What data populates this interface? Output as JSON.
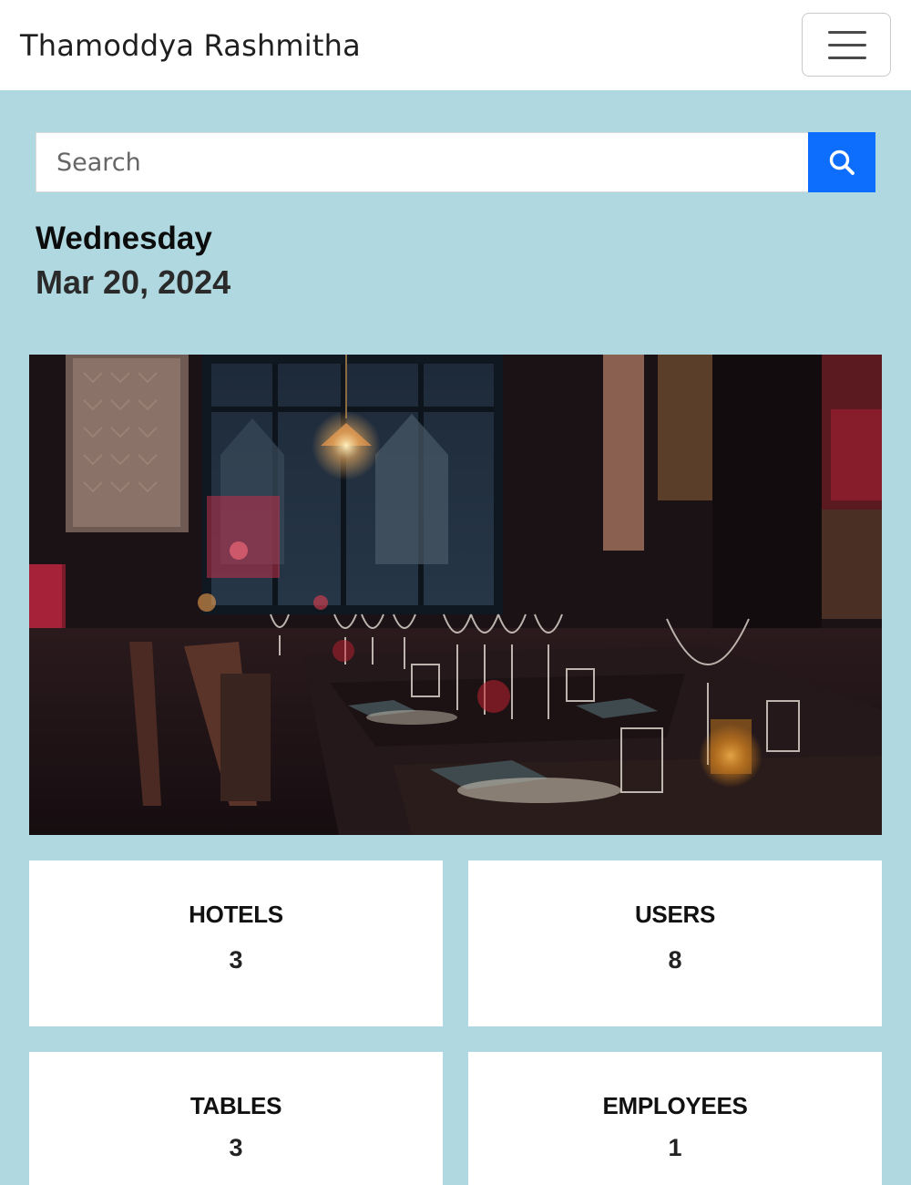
{
  "navbar": {
    "brand": "Thamoddya Rashmitha",
    "toggler_icon": "hamburger-menu-icon"
  },
  "search": {
    "placeholder": "Search",
    "value": "",
    "button_icon": "search-icon",
    "button_color": "#0d6efd"
  },
  "today": {
    "weekday": "Wednesday",
    "date": "Mar 20, 2024"
  },
  "hero": {
    "subject": "restaurant-interior-photo"
  },
  "stats": [
    {
      "label": "HOTELS",
      "value": "3"
    },
    {
      "label": "USERS",
      "value": "8"
    },
    {
      "label": "TABLES",
      "value": "3"
    },
    {
      "label": "EMPLOYEES",
      "value": "1"
    }
  ],
  "colors": {
    "page_background": "#b0d8e0",
    "navbar_background": "#ffffff",
    "card_background": "#ffffff"
  }
}
